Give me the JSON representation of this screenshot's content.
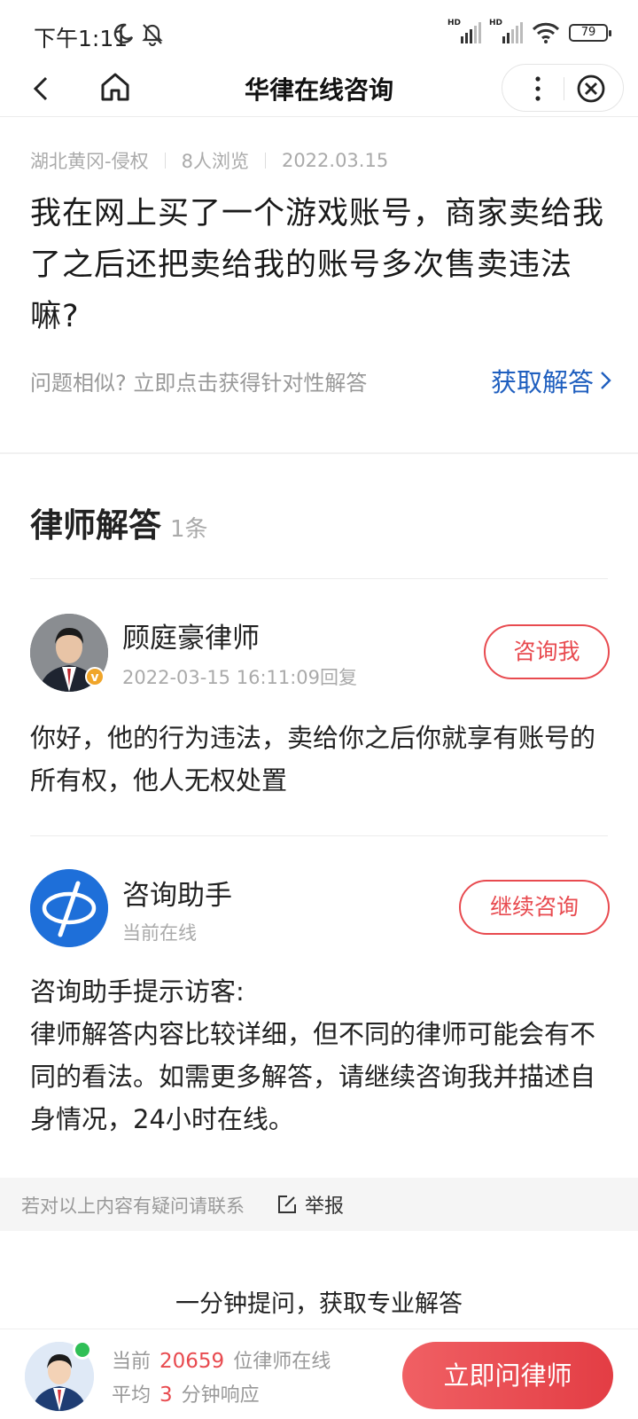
{
  "status_bar": {
    "time": "下午1:11",
    "battery": "79"
  },
  "nav": {
    "title": "华律在线咨询"
  },
  "question": {
    "location_category": "湖北黄冈-侵权",
    "views": "8人浏览",
    "date": "2022.03.15",
    "text": "我在网上买了一个游戏账号，商家卖给我了之后还把卖给我的账号多次售卖违法嘛?",
    "similar_prompt": "问题相似? 立即点击获得针对性解答",
    "get_answer_label": "获取解答"
  },
  "answers": {
    "title": "律师解答",
    "count": "1条",
    "lawyer": {
      "name": "顾庭豪律师",
      "replied_at": "2022-03-15 16:11:09回复",
      "button_label": "咨询我",
      "verified_badge": "v",
      "answer": "你好，他的行为违法，卖给你之后你就享有账号的所有权，他人无权处置"
    },
    "assistant": {
      "name": "咨询助手",
      "status": "当前在线",
      "button_label": "继续咨询",
      "tip_title": "咨询助手提示访客:",
      "tip_body": "律师解答内容比较详细，但不同的律师可能会有不同的看法。如需更多解答，请继续咨询我并描述自身情况，24小时在线。"
    }
  },
  "report": {
    "text": "若对以上内容有疑问请联系",
    "link_label": "举报"
  },
  "cta": {
    "caption": "一分钟提问，获取专业解答"
  },
  "bottom_bar": {
    "line1_prefix": "当前",
    "online_lawyers": "20659",
    "line1_suffix": "位律师在线",
    "line2_prefix": "平均",
    "response_minutes": "3",
    "line2_suffix": "分钟响应",
    "ask_button_label": "立即问律师"
  },
  "colors": {
    "accent_red": "#e84a4f",
    "link_blue": "#1f5fbf",
    "online_green": "#2fbf56",
    "badge_gold": "#f0a52a"
  },
  "icons": [
    "moon-icon",
    "mute-bell-icon",
    "signal-icon",
    "wifi-icon",
    "battery-icon",
    "back-icon",
    "home-icon",
    "more-icon",
    "close-icon",
    "chevron-right-icon",
    "edit-icon"
  ]
}
